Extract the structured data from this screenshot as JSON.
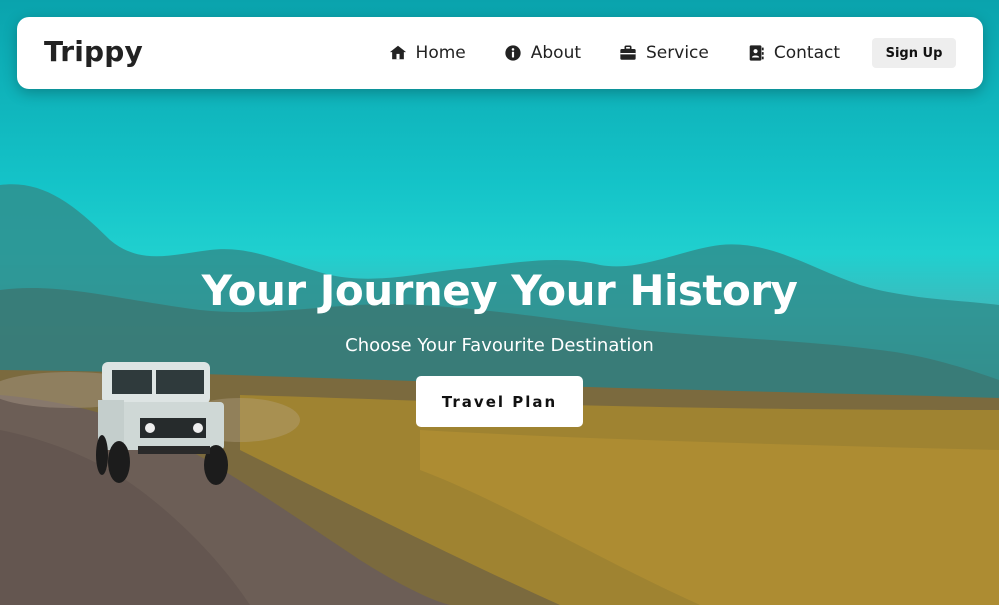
{
  "navbar": {
    "brand": "Trippy",
    "links": [
      {
        "label": "Home",
        "icon": "house-icon"
      },
      {
        "label": "About",
        "icon": "info-circle-icon"
      },
      {
        "label": "Service",
        "icon": "briefcase-icon"
      },
      {
        "label": "Contact",
        "icon": "address-book-icon"
      }
    ],
    "signup_label": "Sign Up"
  },
  "hero": {
    "title": "Your Journey Your History",
    "subtitle": "Choose Your Favourite Destination",
    "cta_label": "Travel Plan"
  },
  "colors": {
    "sky": "#14c3c8",
    "navbar_bg": "#ffffff",
    "text_dark": "#222222",
    "button_light": "#eeeeee"
  }
}
